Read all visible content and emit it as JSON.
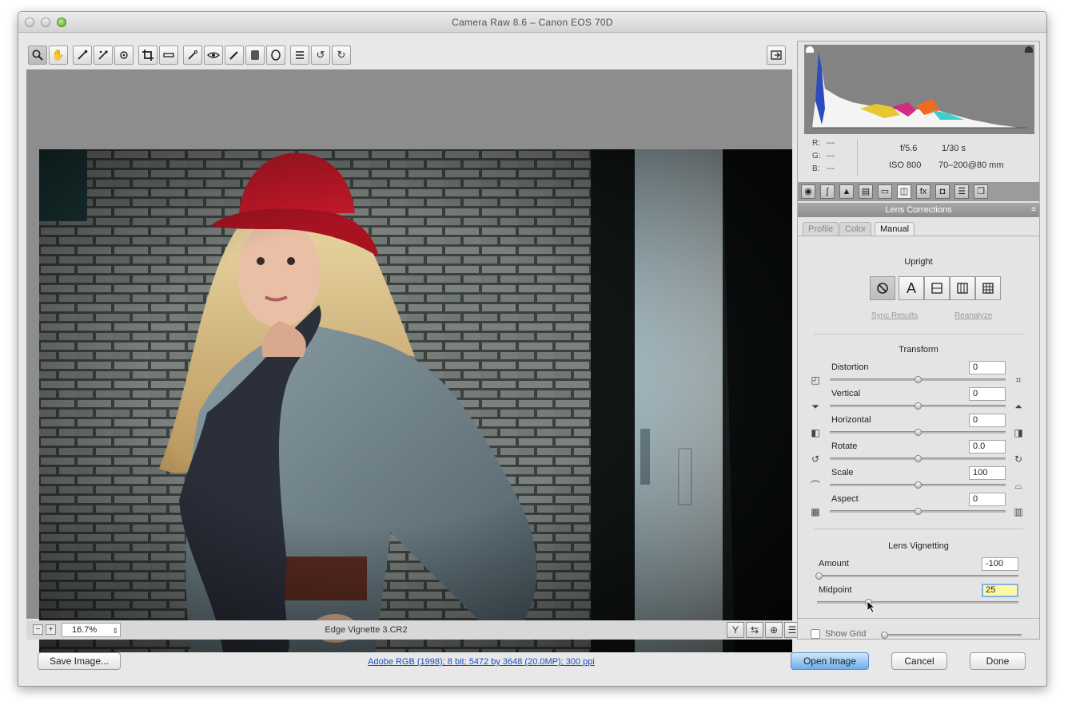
{
  "window": {
    "title": "Camera Raw 8.6  –  Canon EOS 70D"
  },
  "toolbar": {
    "tools": [
      "zoom-tool",
      "hand-tool",
      "white-balance-tool",
      "color-sampler-tool",
      "targeted-adjustment-tool",
      "crop-tool",
      "straighten-tool",
      "spot-removal-tool",
      "red-eye-tool",
      "adjustment-brush",
      "graduated-filter",
      "radial-filter",
      "preferences",
      "rotate-ccw",
      "rotate-cw"
    ],
    "active_tool": "zoom-tool"
  },
  "preview": {
    "zoom": "16.7%",
    "filename": "Edge Vignette 3.CR2"
  },
  "readout": {
    "r_label": "R:",
    "r_value": "---",
    "g_label": "G:",
    "g_value": "---",
    "b_label": "B:",
    "b_value": "---",
    "aperture": "f/5.6",
    "shutter": "1/30 s",
    "iso": "ISO 800",
    "lens": "70–200@80 mm"
  },
  "panel": {
    "section": "Lens Corrections",
    "subtabs": [
      "Profile",
      "Color",
      "Manual"
    ],
    "active_subtab": "Manual",
    "upright": {
      "title": "Upright",
      "a_label": "A",
      "sync_results": "Sync Results",
      "reanalyze": "Reanalyze"
    },
    "transform": {
      "title": "Transform",
      "sliders": [
        {
          "label": "Distortion",
          "value": "0"
        },
        {
          "label": "Vertical",
          "value": "0"
        },
        {
          "label": "Horizontal",
          "value": "0"
        },
        {
          "label": "Rotate",
          "value": "0.0"
        },
        {
          "label": "Scale",
          "value": "100"
        },
        {
          "label": "Aspect",
          "value": "0"
        }
      ]
    },
    "vignetting": {
      "title": "Lens Vignetting",
      "amount_label": "Amount",
      "amount_value": "-100",
      "midpoint_label": "Midpoint",
      "midpoint_value": "25"
    },
    "show_grid": "Show Grid"
  },
  "footer": {
    "save_label": "Save Image...",
    "workflow_info": "Adobe RGB (1998); 8 bit; 5472 by 3648 (20.0MP); 300 ppi",
    "open_label": "Open Image",
    "cancel_label": "Cancel",
    "done_label": "Done"
  },
  "colors": {
    "accent": "#6eaee9",
    "hat": "#c8192a",
    "link": "#1b4fbf"
  }
}
